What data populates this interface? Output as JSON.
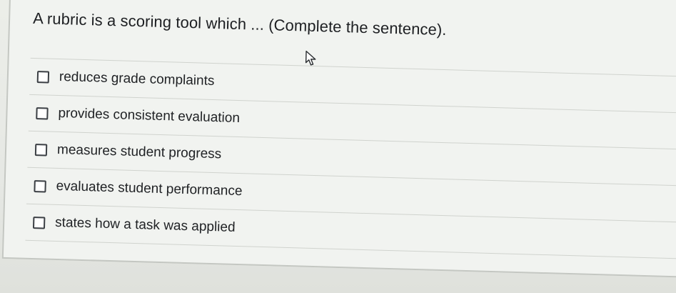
{
  "question": {
    "text": "A rubric is a scoring tool which ... (Complete the sentence)."
  },
  "options": [
    {
      "label": "reduces grade complaints",
      "checked": false
    },
    {
      "label": "provides consistent evaluation",
      "checked": false
    },
    {
      "label": "measures student progress",
      "checked": false
    },
    {
      "label": "evaluates student performance",
      "checked": false
    },
    {
      "label": "states how a task was applied",
      "checked": false
    }
  ],
  "cursor": {
    "icon": "arrow-pointer-icon"
  },
  "colors": {
    "background": "#e9ebe8",
    "panel": "#f1f3f0",
    "text": "#1d1f22",
    "checkbox_border": "#3b3f44",
    "divider": "#d0d3ce"
  }
}
